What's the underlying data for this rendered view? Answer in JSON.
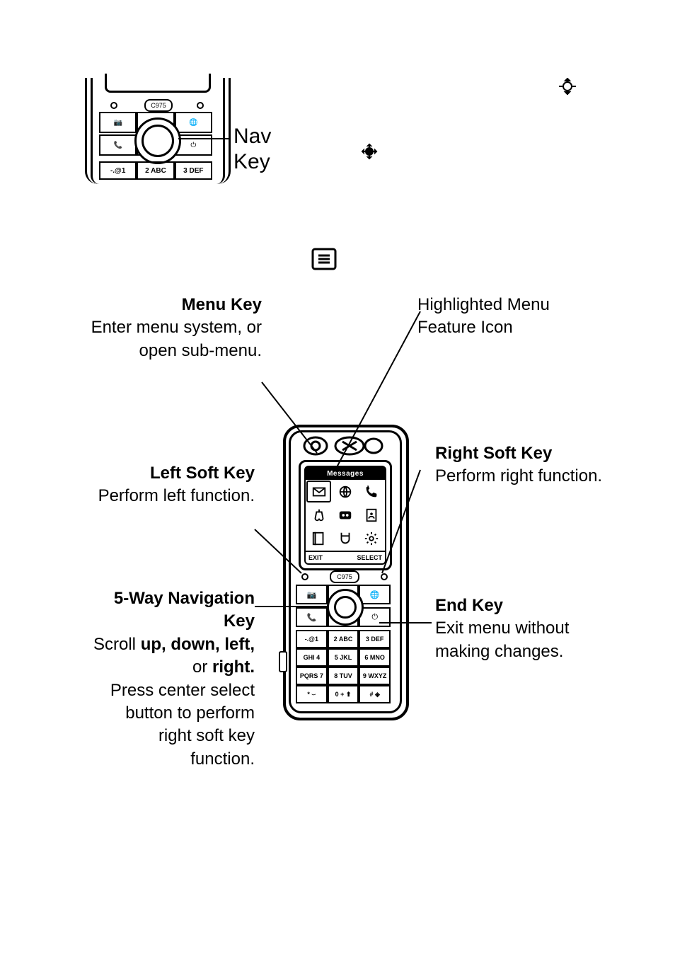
{
  "phone_model": "C975",
  "top_label": {
    "line1": "Nav",
    "line2": "Key"
  },
  "menu_screen": {
    "title": "Messages",
    "left_soft_label": "EXIT",
    "right_soft_label": "SELECT",
    "icons": [
      "messages",
      "browser",
      "recent-calls",
      "games",
      "media",
      "phonebook",
      "office",
      "tools",
      "settings"
    ]
  },
  "keypad": {
    "row1": [
      "-.@1",
      "2 ABC",
      "3 DEF"
    ],
    "row2": [
      "GHI 4",
      "5 JKL",
      "6 MNO"
    ],
    "row3": [
      "PQRS 7",
      "8 TUV",
      "9 WXYZ"
    ],
    "row4": [
      "* ⌣",
      "0 + ⬆",
      "# ◈"
    ]
  },
  "callouts": {
    "menu_key": {
      "title": "Menu Key",
      "body": "Enter menu system, or open sub-menu."
    },
    "highlighted": {
      "body": "Highlighted Menu Feature Icon"
    },
    "left_soft_key": {
      "title": "Left Soft Key",
      "body": "Perform left function."
    },
    "right_soft_key": {
      "title": "Right Soft Key",
      "body": "Perform right function."
    },
    "five_way": {
      "title": "5-Way Navigation Key",
      "l1": "Scroll ",
      "l1_b": "up, down, left,",
      "l1_or": " or ",
      "l1_b2": "right.",
      "l2": "Press center select button to perform right soft key function."
    },
    "end_key": {
      "title": "End Key",
      "body": "Exit menu without making changes."
    }
  }
}
